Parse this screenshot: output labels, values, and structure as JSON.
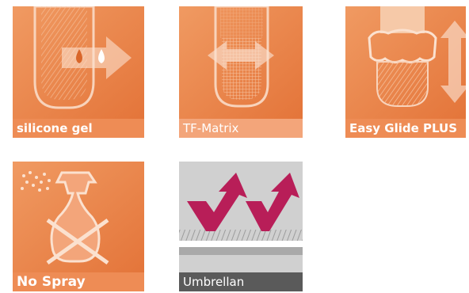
{
  "tiles": [
    {
      "label": "silicone gel",
      "icon": "silicone-gel-icon"
    },
    {
      "label": "TF-Matrix",
      "icon": "tf-matrix-icon"
    },
    {
      "label": "Easy Glide PLUS",
      "icon": "easy-glide-icon"
    },
    {
      "label": "No Spray",
      "icon": "no-spray-icon"
    },
    {
      "label": "Umbrellan",
      "icon": "umbrellan-icon"
    }
  ],
  "colors": {
    "orange_dark": "#e87a3d",
    "orange_light": "#f3a57a",
    "label_band": "#ee8c55",
    "gray_panel": "#cfcfcf",
    "gray_band": "#5a5a5a",
    "magenta": "#b81e58"
  }
}
